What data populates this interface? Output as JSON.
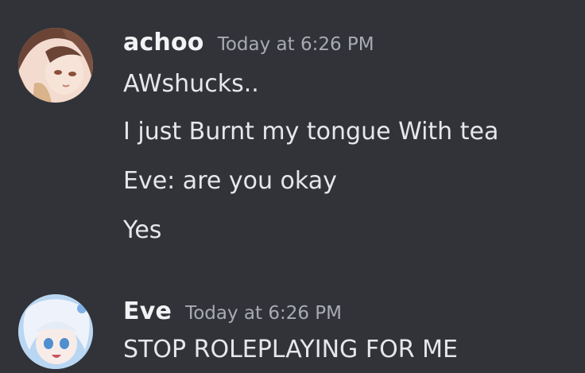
{
  "messages": [
    {
      "username": "achoo",
      "timestamp": "Today at 6:26 PM",
      "avatar_icon": "anime-avatar-brown-hair",
      "lines": [
        "AWshucks..",
        "I just Burnt my tongue   With tea",
        "Eve:  are you okay",
        "Yes"
      ]
    },
    {
      "username": "Eve",
      "timestamp": "Today at 6:26 PM",
      "avatar_icon": "anime-avatar-white-hair",
      "lines": [
        "STOP ROLEPLAYING FOR ME"
      ]
    }
  ],
  "colors": {
    "background": "#313338",
    "username": "#f2f3f5",
    "timestamp": "#a8abb2",
    "message_text": "#e6e7ea"
  }
}
